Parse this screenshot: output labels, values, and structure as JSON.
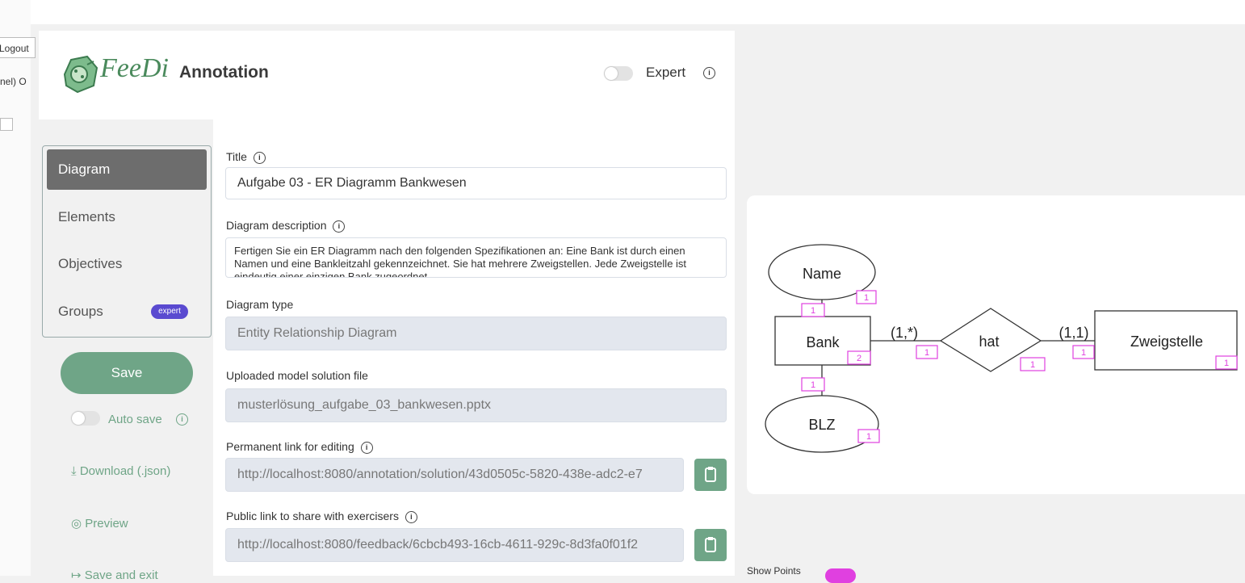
{
  "browser": {
    "logout_label": "Logout",
    "panel_text": "nel) O"
  },
  "header": {
    "title": "Annotation",
    "expert_label": "Expert",
    "logo_text": "FeeDi"
  },
  "nav": {
    "items": [
      {
        "label": "Diagram",
        "active": true
      },
      {
        "label": "Elements",
        "active": false
      },
      {
        "label": "Objectives",
        "active": false
      },
      {
        "label": "Groups",
        "active": false
      }
    ],
    "groups_badge": "expert"
  },
  "actions": {
    "save_label": "Save",
    "autosave_label": "Auto save",
    "download_label": "Download (.json)",
    "preview_label": "Preview",
    "save_exit_label": "Save and exit"
  },
  "form": {
    "title_label": "Title",
    "title_value": "Aufgabe 03 - ER Diagramm Bankwesen",
    "description_label": "Diagram description",
    "description_value": "Fertigen Sie ein ER Diagramm nach den folgenden Spezifikationen an: Eine Bank ist durch einen Namen und eine Bankleitzahl gekennzeichnet. Sie hat mehrere Zweigstellen. Jede Zweigstelle ist eindeutig einer einzigen Bank zugeordnet.",
    "type_label": "Diagram type",
    "type_value": "Entity Relationship Diagram",
    "uploaded_label": "Uploaded model solution file",
    "uploaded_value": "musterlösung_aufgabe_03_bankwesen.pptx",
    "permalink_label": "Permanent link for editing",
    "permalink_value": "http://localhost:8080/annotation/solution/43d0505c-5820-438e-adc2-e7",
    "public_label": "Public link to share with exercisers",
    "public_value": "http://localhost:8080/feedback/6cbcb493-16cb-4611-929c-8d3fa0f01f2"
  },
  "diagram": {
    "entities": [
      "Bank",
      "Zweigstelle"
    ],
    "attributes": [
      "Name",
      "BLZ"
    ],
    "relationship": "hat",
    "cardinality_left": "(1,*)",
    "cardinality_right": "(1,1)",
    "badge_one": "1",
    "badge_two": "2",
    "accent_color": "#e040e0"
  },
  "bottom": {
    "show_points_label": "Show Points"
  }
}
